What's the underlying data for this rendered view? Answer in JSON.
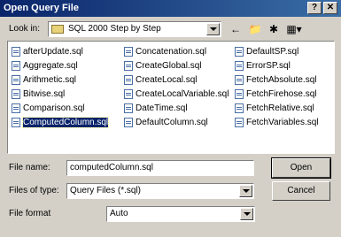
{
  "dialog": {
    "title": "Open Query File",
    "help_glyph": "?",
    "close_glyph": "✕"
  },
  "look_in": {
    "label": "Look in:",
    "value": "SQL 2000 Step by Step",
    "toolbar": [
      "←",
      "📁",
      "✱",
      "▦▾"
    ]
  },
  "files": {
    "col1": [
      "afterUpdate.sql",
      "Aggregate.sql",
      "Arithmetic.sql",
      "Bitwise.sql",
      "Comparison.sql",
      "ComputedColumn.sql"
    ],
    "col2": [
      "Concatenation.sql",
      "CreateGlobal.sql",
      "CreateLocal.sql",
      "CreateLocalVariable.sql",
      "DateTime.sql",
      "DefaultColumn.sql"
    ],
    "col3": [
      "DefaultSP.sql",
      "ErrorSP.sql",
      "FetchAbsolute.sql",
      "FetchFirehose.sql",
      "FetchRelative.sql",
      "FetchVariables.sql"
    ],
    "selected": "ComputedColumn.sql"
  },
  "form": {
    "file_name_label": "File name:",
    "file_name_value": "computedColumn.sql",
    "files_of_type_label": "Files of type:",
    "files_of_type_value": "Query Files (*.sql)",
    "file_format_label": "File format",
    "file_format_value": "Auto"
  },
  "buttons": {
    "open": "Open",
    "cancel": "Cancel"
  },
  "colors": {
    "title_bar": "#0a246a",
    "selection": "#0a246a",
    "face": "#d4d0c8"
  }
}
